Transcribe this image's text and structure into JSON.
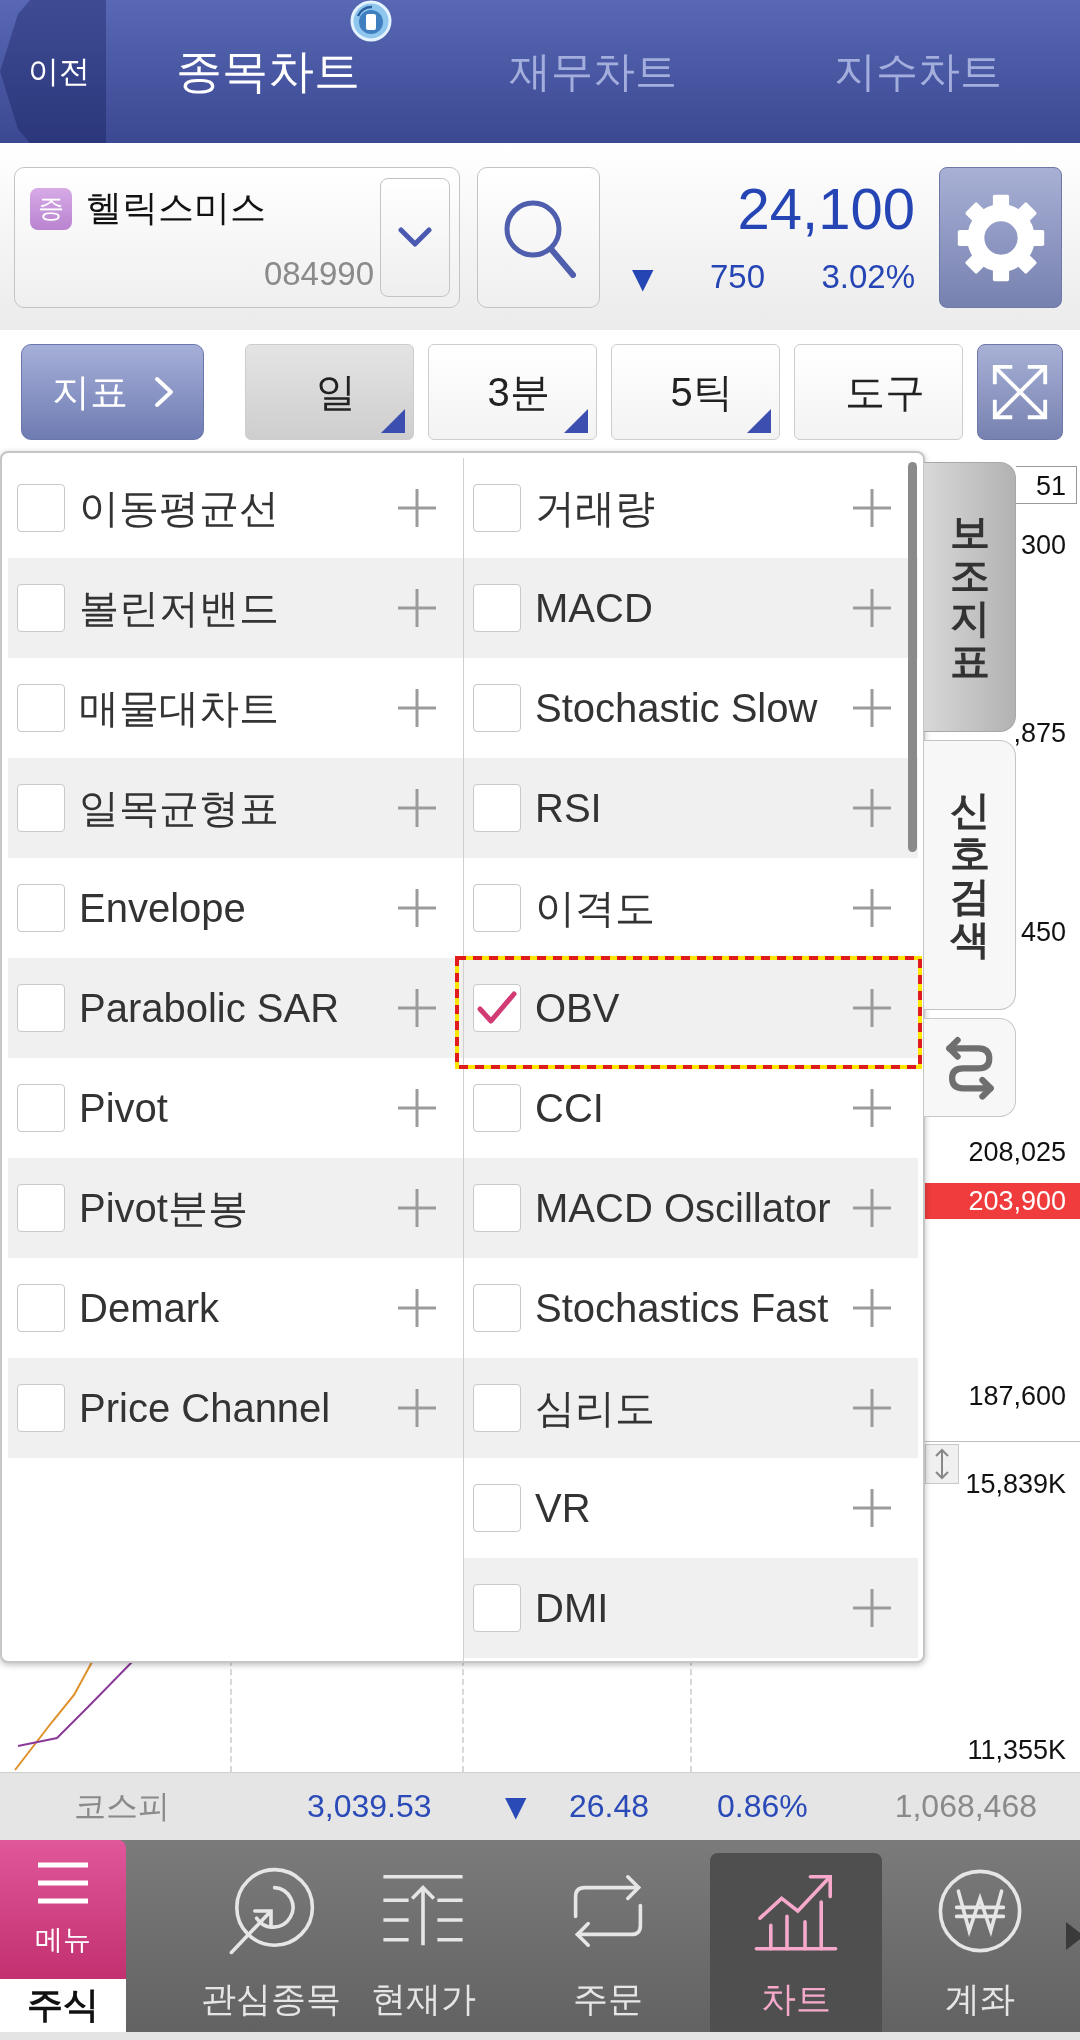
{
  "header": {
    "back_button": "이전",
    "tabs": [
      {
        "label": "종목차트",
        "selected": true
      },
      {
        "label": "재무차트",
        "selected": false
      },
      {
        "label": "지수차트",
        "selected": false
      }
    ]
  },
  "stock": {
    "market_badge": "증",
    "name": "헬릭스미스",
    "code": "084990",
    "price": "24,100",
    "change_mark": "▼",
    "change": "750",
    "change_rate": "3.02%"
  },
  "toolbar": {
    "indicator_button": "지표",
    "buttons": [
      {
        "label": "일",
        "kind": "dropdown",
        "selected": true
      },
      {
        "label": "3분",
        "kind": "dropdown",
        "selected": false
      },
      {
        "label": "5틱",
        "kind": "dropdown",
        "selected": false
      },
      {
        "label": "도구",
        "kind": "plain",
        "selected": false
      }
    ]
  },
  "indicator_panel": {
    "columns": [
      {
        "items": [
          {
            "label": "이동평균선",
            "checked": false,
            "highlighted": false
          },
          {
            "label": "볼린저밴드",
            "checked": false,
            "highlighted": false
          },
          {
            "label": "매물대차트",
            "checked": false,
            "highlighted": false
          },
          {
            "label": "일목균형표",
            "checked": false,
            "highlighted": false
          },
          {
            "label": "Envelope",
            "checked": false,
            "highlighted": false
          },
          {
            "label": "Parabolic SAR",
            "checked": false,
            "highlighted": false
          },
          {
            "label": "Pivot",
            "checked": false,
            "highlighted": false
          },
          {
            "label": "Pivot분봉",
            "checked": false,
            "highlighted": false
          },
          {
            "label": "Demark",
            "checked": false,
            "highlighted": false
          },
          {
            "label": "Price Channel",
            "checked": false,
            "highlighted": false
          }
        ]
      },
      {
        "items": [
          {
            "label": "거래량",
            "checked": false,
            "highlighted": false
          },
          {
            "label": "MACD",
            "checked": false,
            "highlighted": false
          },
          {
            "label": "Stochastic Slow",
            "checked": false,
            "highlighted": false
          },
          {
            "label": "RSI",
            "checked": false,
            "highlighted": false
          },
          {
            "label": "이격도",
            "checked": false,
            "highlighted": false
          },
          {
            "label": "OBV",
            "checked": true,
            "highlighted": true
          },
          {
            "label": "CCI",
            "checked": false,
            "highlighted": false
          },
          {
            "label": "MACD Oscillator",
            "checked": false,
            "highlighted": false
          },
          {
            "label": "Stochastics Fast",
            "checked": false,
            "highlighted": false
          },
          {
            "label": "심리도",
            "checked": false,
            "highlighted": false
          },
          {
            "label": "VR",
            "checked": false,
            "highlighted": false
          },
          {
            "label": "DMI",
            "checked": false,
            "highlighted": false
          }
        ]
      }
    ]
  },
  "side_tabs": [
    {
      "label": "보조지표",
      "selected": true
    },
    {
      "label": "신호검색",
      "selected": false
    }
  ],
  "axis_labels": [
    {
      "text": "51",
      "kind": "boxed"
    },
    {
      "text": "300",
      "kind": "plain"
    },
    {
      "text": ",875",
      "kind": "plain"
    },
    {
      "text": "450",
      "kind": "plain"
    },
    {
      "text": "208,025",
      "kind": "plain"
    },
    {
      "text": "203,900",
      "kind": "current"
    },
    {
      "text": "187,600",
      "kind": "plain"
    },
    {
      "text": "15,839K",
      "kind": "plain"
    },
    {
      "text": "11,355K",
      "kind": "plain"
    }
  ],
  "index_bar": {
    "name": "코스피",
    "value": "3,039.53",
    "change_mark": "▼",
    "change": "26.48",
    "change_rate": "0.86%",
    "volume": "1,068,468"
  },
  "bottom_nav": {
    "menu_button": "메뉴",
    "section": "주식",
    "items": [
      {
        "label": "관심종목",
        "selected": false
      },
      {
        "label": "현재가",
        "selected": false
      },
      {
        "label": "주문",
        "selected": false
      },
      {
        "label": "차트",
        "selected": true
      },
      {
        "label": "계좌",
        "selected": false
      }
    ]
  }
}
